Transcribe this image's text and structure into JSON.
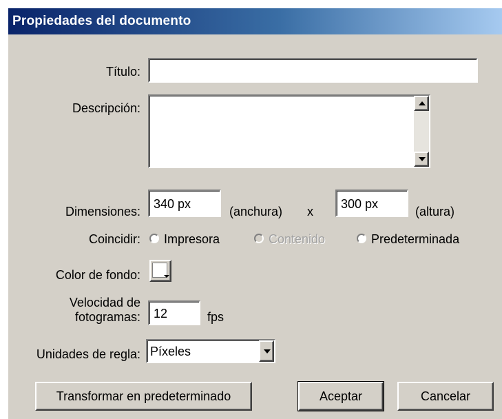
{
  "dialog": {
    "title": "Propiedades del documento"
  },
  "fields": {
    "titulo_label": "Título:",
    "titulo_value": "",
    "descripcion_label": "Descripción:",
    "descripcion_value": "",
    "dimensiones_label": "Dimensiones:",
    "width_value": "340 px",
    "width_suffix": "(anchura)",
    "x_separator": "x",
    "height_value": "300 px",
    "height_suffix": "(altura)",
    "coincidir_label": "Coincidir:",
    "coincidir_options": [
      "Impresora",
      "Contenido",
      "Predeterminada"
    ],
    "color_fondo_label": "Color de fondo:",
    "color_fondo_value": "#ffffff",
    "velocidad_label_line1": "Velocidad de",
    "velocidad_label_line2": "fotogramas:",
    "velocidad_value": "12",
    "velocidad_unit": "fps",
    "unidades_label": "Unidades de regla:",
    "unidades_value": "Píxeles"
  },
  "buttons": {
    "transformar": "Transformar en predeterminado",
    "aceptar": "Aceptar",
    "cancelar": "Cancelar"
  },
  "icons": {
    "scroll_up": "scroll-up-arrow-icon",
    "scroll_down": "scroll-down-arrow-icon",
    "dropdown": "dropdown-arrow-icon"
  }
}
